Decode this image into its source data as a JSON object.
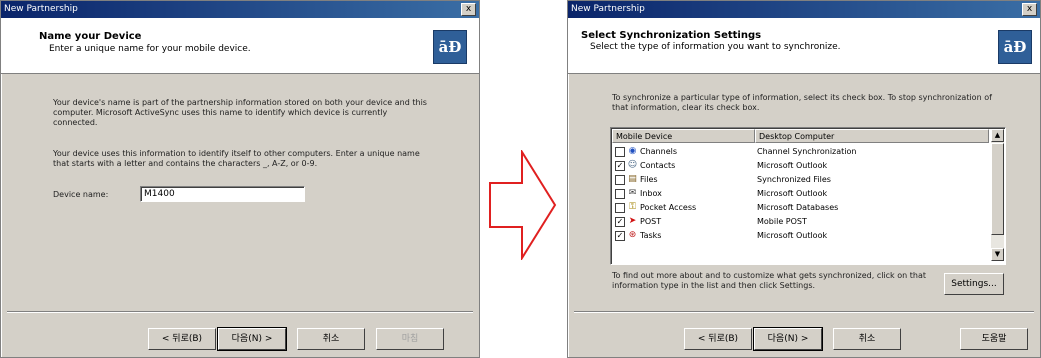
{
  "left_dialog": {
    "title": "New Partnership",
    "close": "x",
    "header_title": "Name your Device",
    "header_subtitle": "Enter a unique name for your mobile device.",
    "logo": "āÐ",
    "para1": "Your device's name is part of the partnership information stored on both your device and this computer. Microsoft ActiveSync uses this name to identify which device is currently connected.",
    "para2": "Your device uses this information to identify itself to other computers. Enter a unique name that starts with a letter and contains the characters _, A-Z, or 0-9.",
    "device_name_label": "Device name:",
    "device_name_value": "M1400",
    "buttons": {
      "back": "< 뒤로(B)",
      "next": "다음(N) >",
      "cancel": "취소",
      "finish": "마침"
    }
  },
  "arrow": {
    "color": "#e02020"
  },
  "right_dialog": {
    "title": "New Partnership",
    "close": "x",
    "header_title": "Select Synchronization Settings",
    "header_subtitle": "Select the type of information you want to synchronize.",
    "logo": "āÐ",
    "instructions": "To synchronize a particular type of information, select its check box. To stop synchronization of that information, clear its check box.",
    "columns": [
      "Mobile Device",
      "Desktop Computer"
    ],
    "rows": [
      {
        "device": "Channels",
        "desktop": "Channel Synchronization",
        "checked": false,
        "icon": "channels-icon"
      },
      {
        "device": "Contacts",
        "desktop": "Microsoft Outlook",
        "checked": true,
        "icon": "contacts-icon"
      },
      {
        "device": "Files",
        "desktop": "Synchronized Files",
        "checked": false,
        "icon": "files-icon"
      },
      {
        "device": "Inbox",
        "desktop": "Microsoft Outlook",
        "checked": false,
        "icon": "inbox-icon"
      },
      {
        "device": "Pocket Access",
        "desktop": "Microsoft Databases",
        "checked": false,
        "icon": "pocket-access-icon"
      },
      {
        "device": "POST",
        "desktop": "Mobile POST",
        "checked": true,
        "icon": "post-icon"
      },
      {
        "device": "Tasks",
        "desktop": "Microsoft Outlook",
        "checked": true,
        "icon": "tasks-icon"
      }
    ],
    "settings_hint": "To find out more about and to customize what gets synchronized, click on that information type in the list and then click Settings.",
    "settings_button": "Settings...",
    "buttons": {
      "back": "< 뒤로(B)",
      "next": "다음(N) >",
      "cancel": "취소",
      "help": "도움말"
    }
  }
}
